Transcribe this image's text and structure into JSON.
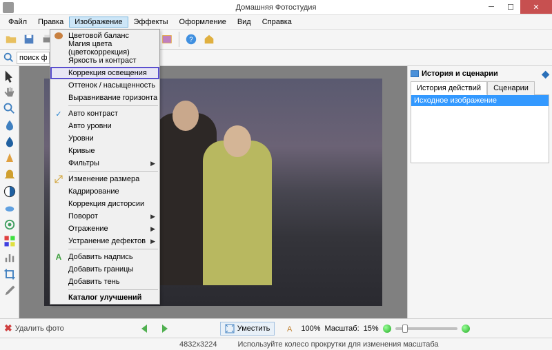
{
  "title": "Домашняя Фотостудия",
  "menubar": [
    "Файл",
    "Правка",
    "Изображение",
    "Эффекты",
    "Оформление",
    "Вид",
    "Справка"
  ],
  "active_menu_index": 2,
  "dropdown": {
    "items": [
      {
        "label": "Цветовой баланс",
        "icon": "palette"
      },
      {
        "label": "Магия цвета (цветокоррекция)"
      },
      {
        "label": "Яркость и контраст"
      },
      {
        "label": "Коррекция освещения",
        "highlight": true
      },
      {
        "label": "Оттенок / насыщенность"
      },
      {
        "label": "Выравнивание горизонта"
      },
      {
        "divider": true
      },
      {
        "label": "Авто контраст",
        "icon": "check"
      },
      {
        "label": "Авто уровни"
      },
      {
        "label": "Уровни"
      },
      {
        "label": "Кривые"
      },
      {
        "label": "Фильтры",
        "submenu": true
      },
      {
        "divider": true
      },
      {
        "label": "Изменение размера",
        "icon": "resize"
      },
      {
        "label": "Кадрирование"
      },
      {
        "label": "Коррекция дисторсии"
      },
      {
        "label": "Поворот",
        "submenu": true
      },
      {
        "label": "Отражение",
        "submenu": true
      },
      {
        "label": "Устранение дефектов",
        "submenu": true
      },
      {
        "divider": true
      },
      {
        "label": "Добавить надпись",
        "icon": "text"
      },
      {
        "label": "Добавить границы"
      },
      {
        "label": "Добавить тень"
      },
      {
        "divider": true
      },
      {
        "label": "Каталог улучшений",
        "bold": true
      }
    ]
  },
  "search_placeholder": "поиск фу",
  "right_panel": {
    "title": "История и сценарии",
    "tabs": [
      "История действий",
      "Сценарии"
    ],
    "active_tab": 0,
    "history_items": [
      "Исходное изображение"
    ]
  },
  "bottom": {
    "delete_label": "Удалить фото",
    "fit_label": "Уместить",
    "zoom_100": "100%",
    "scale_label": "Масштаб:",
    "scale_value": "15%"
  },
  "status": {
    "dimensions": "4832x3224",
    "hint": "Используйте колесо прокрутки для изменения масштаба"
  }
}
